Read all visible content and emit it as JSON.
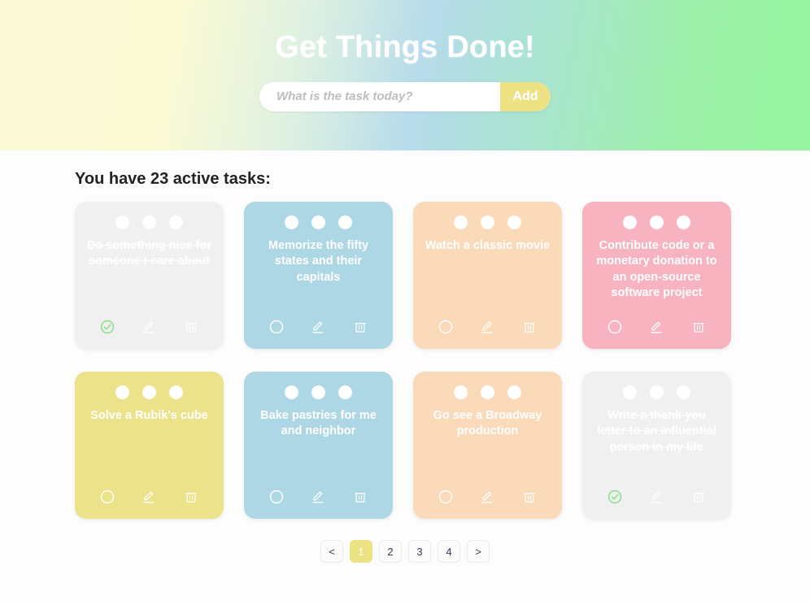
{
  "header": {
    "title": "Get Things Done!",
    "input_placeholder": "What is the task today?",
    "input_value": "",
    "add_label": "Add",
    "gradient_from": "#fcfbd8",
    "gradient_mid": "#b6dbea",
    "gradient_to": "#95f59f",
    "accent_yellow": "#ece183"
  },
  "main": {
    "section_title": "You have 23 active tasks:",
    "active_task_count": 23
  },
  "tasks": [
    {
      "text": "Do something nice for someone I care about",
      "color": "gray",
      "completed": true,
      "status_icon": "check-circle-icon"
    },
    {
      "text": "Memorize the fifty states and their capitals",
      "color": "blue",
      "completed": false,
      "status_icon": "circle-icon"
    },
    {
      "text": "Watch a classic movie",
      "color": "orange",
      "completed": false,
      "status_icon": "circle-icon"
    },
    {
      "text": "Contribute code or a monetary donation to an open-source software project",
      "color": "pink",
      "completed": false,
      "status_icon": "circle-icon"
    },
    {
      "text": "Solve a Rubik's cube",
      "color": "yellow",
      "completed": false,
      "status_icon": "circle-icon"
    },
    {
      "text": "Bake pastries for me and neighbor",
      "color": "blue",
      "completed": false,
      "status_icon": "circle-icon"
    },
    {
      "text": "Go see a Broadway production",
      "color": "orange",
      "completed": false,
      "status_icon": "circle-icon"
    },
    {
      "text": "Write a thank you letter to an influential person in my life",
      "color": "gray",
      "completed": true,
      "status_icon": "check-circle-icon"
    }
  ],
  "card_icons": {
    "edit": "pencil-icon",
    "delete": "trash-icon",
    "done_color": "#85e085"
  },
  "pagination": {
    "prev_label": "<",
    "next_label": ">",
    "pages": [
      "1",
      "2",
      "3",
      "4"
    ],
    "current_page": "1"
  },
  "colors": {
    "gray": "#eff0ef",
    "blue": "#aed7e5",
    "orange": "#fbdaba",
    "pink": "#f7b3c0",
    "yellow": "#ece289",
    "page_background": "#fdfdfd"
  }
}
